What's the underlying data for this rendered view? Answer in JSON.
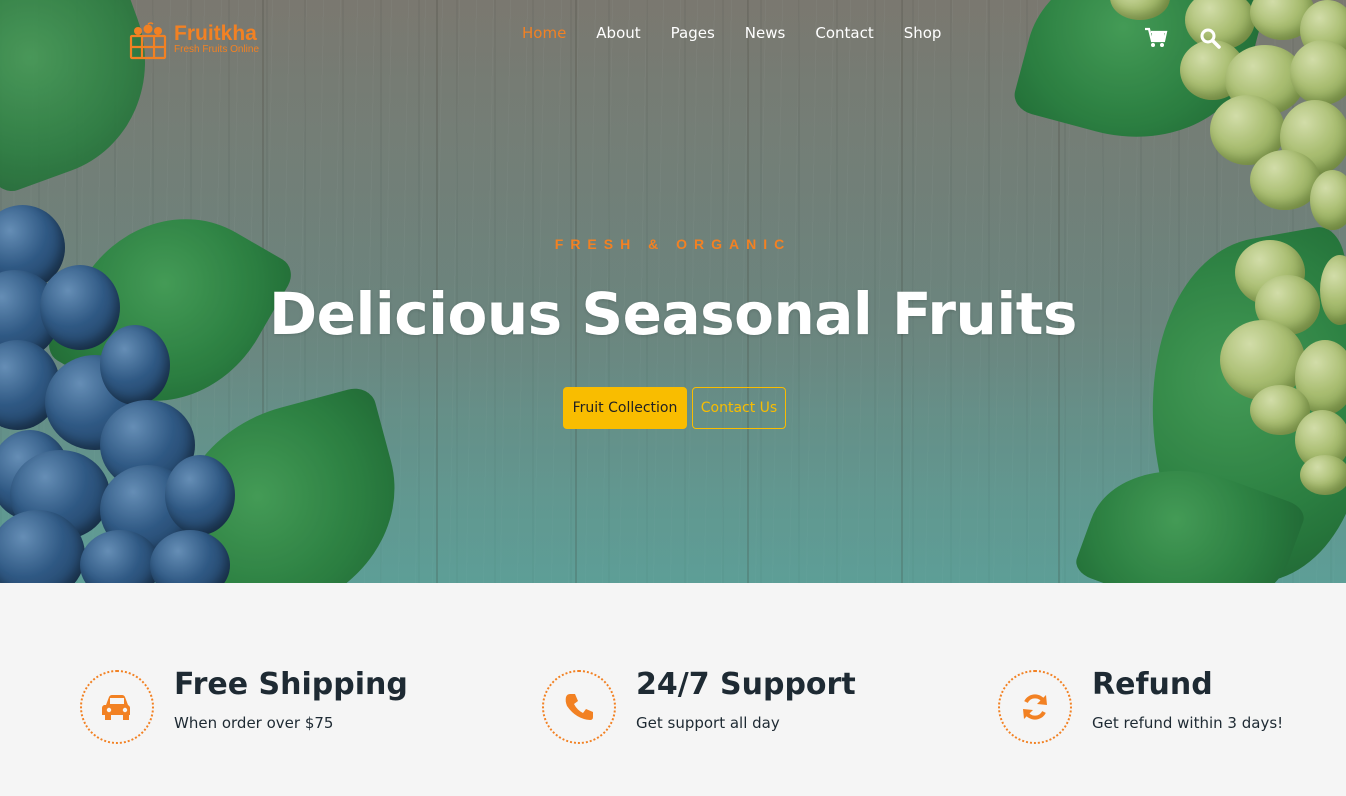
{
  "brand": {
    "name": "Fruitkha",
    "tagline": "Fresh Fruits Online",
    "color": "#f28123"
  },
  "nav": {
    "items": [
      {
        "label": "Home",
        "active": true
      },
      {
        "label": "About"
      },
      {
        "label": "Pages"
      },
      {
        "label": "News"
      },
      {
        "label": "Contact"
      },
      {
        "label": "Shop"
      }
    ],
    "icons": [
      "cart-icon",
      "search-icon"
    ]
  },
  "hero": {
    "subtitle": "FRESH & ORGANIC",
    "headline": "Delicious Seasonal Fruits",
    "primary_button": "Fruit Collection",
    "secondary_button": "Contact Us",
    "button_color": "#f9bd00"
  },
  "features": [
    {
      "icon": "car-icon",
      "title": "Free Shipping",
      "text": "When order over $75"
    },
    {
      "icon": "phone-icon",
      "title": "24/7 Support",
      "text": "Get support all day"
    },
    {
      "icon": "refresh-icon",
      "title": "Refund",
      "text": "Get refund within 3 days!"
    }
  ]
}
